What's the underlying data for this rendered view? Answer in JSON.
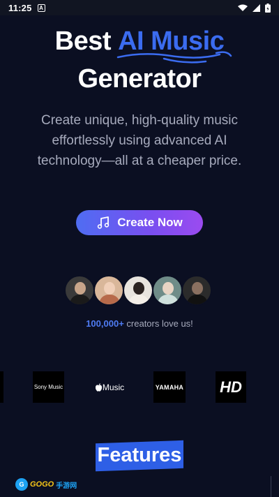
{
  "status_bar": {
    "time": "11:25",
    "notification_icon": "A",
    "icons": [
      "wifi-icon",
      "signal-icon",
      "battery-icon"
    ]
  },
  "hero": {
    "title_prefix": "Best",
    "title_accent": "AI Music",
    "title_line2": "Generator",
    "accent_color": "#3b6cf0",
    "subtitle": "Create unique, high-quality music effortlessly using advanced AI technology—all at a cheaper price."
  },
  "cta": {
    "label": "Create Now",
    "icon": "music-note-icon"
  },
  "social_proof": {
    "count": "100,000+",
    "text": " creators love us!"
  },
  "logos": {
    "sony": "Sony Music",
    "apple": "Music",
    "yamaha": "YAMAHA",
    "hd": "HD"
  },
  "features": {
    "heading": "Features"
  },
  "watermark": {
    "brand": "GOGO",
    "cn": "手游网"
  }
}
